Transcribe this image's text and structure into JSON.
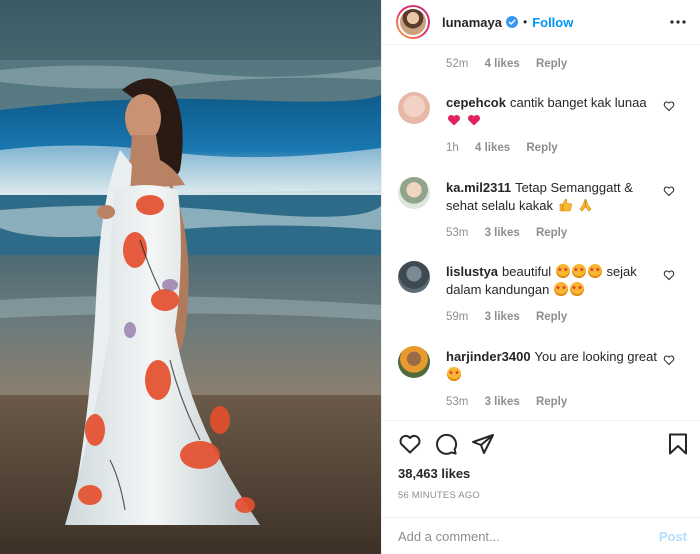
{
  "post": {
    "username": "lunamaya",
    "follow_label": "Follow",
    "separator": "•",
    "likes_count": "38,463 likes",
    "time_ago": "56 MINUTES AGO"
  },
  "top_comment_meta": {
    "time": "52m",
    "likes": "4 likes",
    "reply": "Reply"
  },
  "comments": [
    {
      "user": "cepehcok",
      "text": "cantik banget kak lunaa",
      "time": "1h",
      "likes": "4 likes",
      "reply": "Reply"
    },
    {
      "user": "ka.mil2311",
      "text": "Tetap Semanggatt & sehat selalu kakak",
      "time": "53m",
      "likes": "3 likes",
      "reply": "Reply"
    },
    {
      "user": "lislustya",
      "text": "beautiful",
      "text2": "sejak dalam kandungan",
      "time": "59m",
      "likes": "3 likes",
      "reply": "Reply"
    },
    {
      "user": "harjinder3400",
      "text": "You are looking great",
      "time": "53m",
      "likes": "3 likes",
      "reply": "Reply"
    }
  ],
  "add_comment": {
    "placeholder": "Add a comment...",
    "post_label": "Post"
  },
  "colors": {
    "link_blue": "#0095f6",
    "post_disabled": "#b2dffc",
    "secondary_text": "#8e8e8e",
    "heart_red": "#ed4956"
  },
  "icons": [
    "verified-badge-icon",
    "more-options-icon",
    "heart-icon",
    "comment-icon",
    "share-icon",
    "bookmark-icon"
  ]
}
